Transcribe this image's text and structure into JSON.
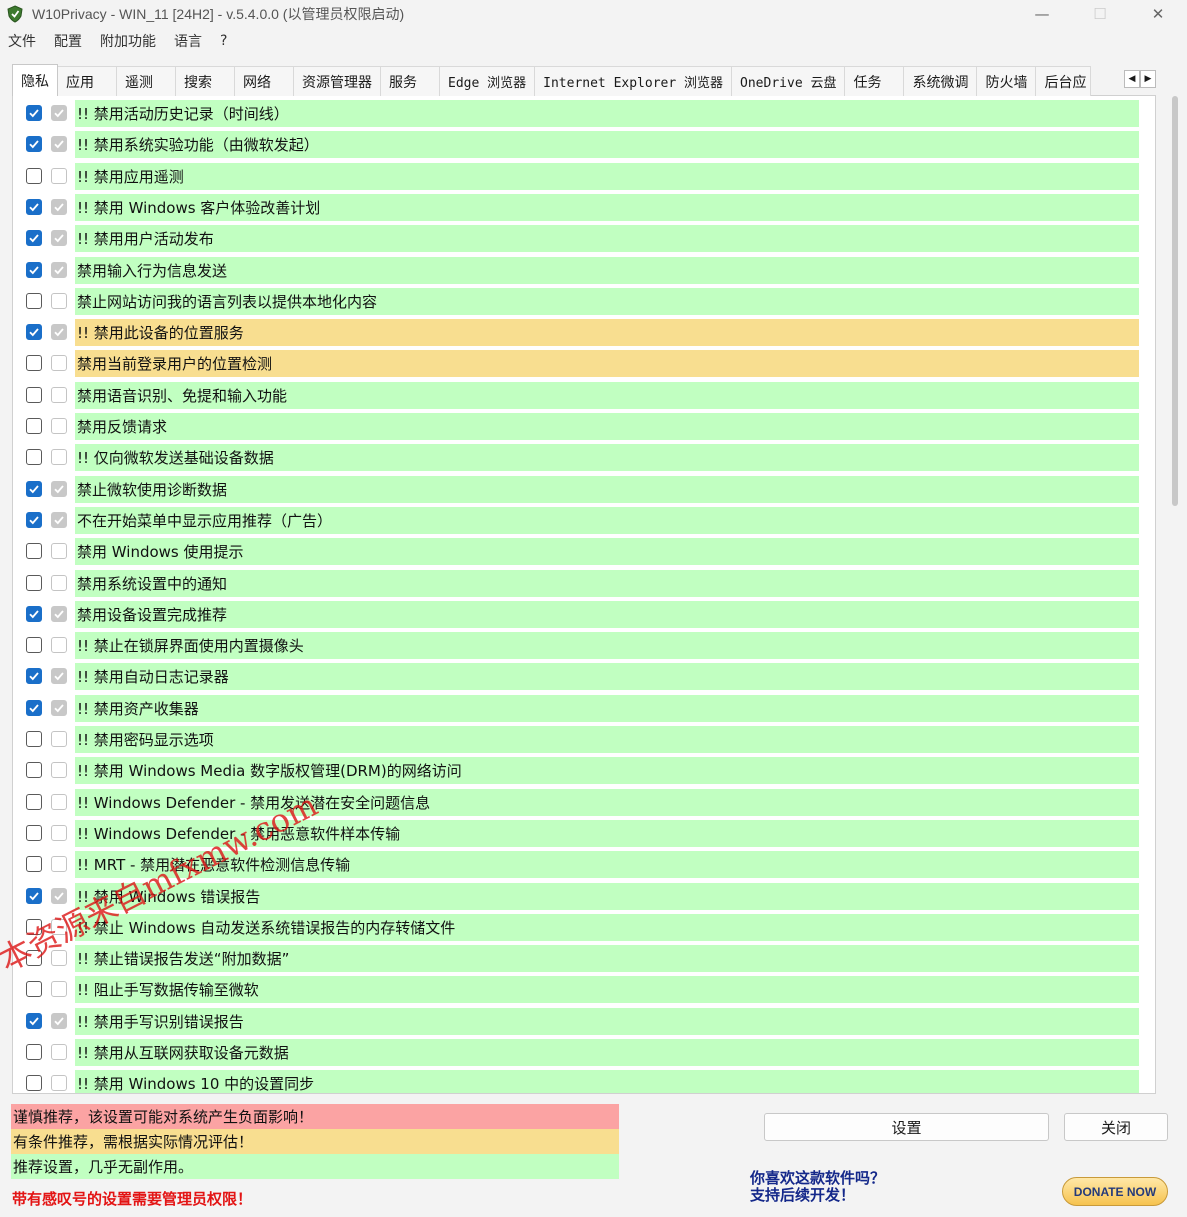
{
  "window": {
    "title": "W10Privacy - WIN_11 [24H2]  - v.5.4.0.0 (以管理员权限启动)",
    "minimize_glyph": "—",
    "maximize_glyph": "☐",
    "close_glyph": "✕"
  },
  "menu": [
    "文件",
    "配置",
    "附加功能",
    "语言",
    "?"
  ],
  "tabs": [
    "隐私",
    "应用",
    "遥测",
    "搜索",
    "网络",
    "资源管理器",
    "服务",
    "Edge 浏览器",
    "Internet Explorer 浏览器",
    "OneDrive 云盘",
    "任务",
    "系统微调",
    "防火墙",
    "后台应"
  ],
  "tab_scroll": [
    "◀",
    "▶"
  ],
  "settings": [
    {
      "label": "!! 禁用活动历史记录（时间线）",
      "checked": true,
      "rec_checked": true,
      "level": "green"
    },
    {
      "label": "!! 禁用系统实验功能（由微软发起）",
      "checked": true,
      "rec_checked": true,
      "level": "green"
    },
    {
      "label": "!! 禁用应用遥测",
      "checked": false,
      "rec_checked": false,
      "level": "green"
    },
    {
      "label": "!! 禁用 Windows 客户体验改善计划",
      "checked": true,
      "rec_checked": true,
      "level": "green"
    },
    {
      "label": "!! 禁用用户活动发布",
      "checked": true,
      "rec_checked": true,
      "level": "green"
    },
    {
      "label": "禁用输入行为信息发送",
      "checked": true,
      "rec_checked": true,
      "level": "green"
    },
    {
      "label": "禁止网站访问我的语言列表以提供本地化内容",
      "checked": false,
      "rec_checked": false,
      "level": "green"
    },
    {
      "label": "!! 禁用此设备的位置服务",
      "checked": true,
      "rec_checked": true,
      "level": "yellow"
    },
    {
      "label": "禁用当前登录用户的位置检测",
      "checked": false,
      "rec_checked": false,
      "level": "yellow"
    },
    {
      "label": "禁用语音识别、免提和输入功能",
      "checked": false,
      "rec_checked": false,
      "level": "green"
    },
    {
      "label": "禁用反馈请求",
      "checked": false,
      "rec_checked": false,
      "level": "green"
    },
    {
      "label": "!! 仅向微软发送基础设备数据",
      "checked": false,
      "rec_checked": false,
      "level": "green"
    },
    {
      "label": "禁止微软使用诊断数据",
      "checked": true,
      "rec_checked": true,
      "level": "green"
    },
    {
      "label": "不在开始菜单中显示应用推荐（广告）",
      "checked": true,
      "rec_checked": true,
      "level": "green"
    },
    {
      "label": "禁用 Windows 使用提示",
      "checked": false,
      "rec_checked": false,
      "level": "green"
    },
    {
      "label": "禁用系统设置中的通知",
      "checked": false,
      "rec_checked": false,
      "level": "green"
    },
    {
      "label": "禁用设备设置完成推荐",
      "checked": true,
      "rec_checked": true,
      "level": "green"
    },
    {
      "label": "!! 禁止在锁屏界面使用内置摄像头",
      "checked": false,
      "rec_checked": false,
      "level": "green"
    },
    {
      "label": "!! 禁用自动日志记录器",
      "checked": true,
      "rec_checked": true,
      "level": "green"
    },
    {
      "label": "!! 禁用资产收集器",
      "checked": true,
      "rec_checked": true,
      "level": "green"
    },
    {
      "label": "!! 禁用密码显示选项",
      "checked": false,
      "rec_checked": false,
      "level": "green"
    },
    {
      "label": "!! 禁用 Windows Media 数字版权管理(DRM)的网络访问",
      "checked": false,
      "rec_checked": false,
      "level": "green"
    },
    {
      "label": "!! Windows Defender - 禁用发送潜在安全问题信息",
      "checked": false,
      "rec_checked": false,
      "level": "green"
    },
    {
      "label": "!! Windows Defender - 禁用恶意软件样本传输",
      "checked": false,
      "rec_checked": false,
      "level": "green"
    },
    {
      "label": "!! MRT - 禁用潜在恶意软件检测信息传输",
      "checked": false,
      "rec_checked": false,
      "level": "green"
    },
    {
      "label": "!! 禁用 Windows 错误报告",
      "checked": true,
      "rec_checked": true,
      "level": "green"
    },
    {
      "label": "!! 禁止 Windows 自动发送系统错误报告的内存转储文件",
      "checked": false,
      "rec_checked": false,
      "level": "green"
    },
    {
      "label": "!! 禁止错误报告发送“附加数据”",
      "checked": false,
      "rec_checked": false,
      "level": "green"
    },
    {
      "label": "!! 阻止手写数据传输至微软",
      "checked": false,
      "rec_checked": false,
      "level": "green"
    },
    {
      "label": "!! 禁用手写识别错误报告",
      "checked": true,
      "rec_checked": true,
      "level": "green"
    },
    {
      "label": "!! 禁用从互联网获取设备元数据",
      "checked": false,
      "rec_checked": false,
      "level": "green"
    },
    {
      "label": "!! 禁用 Windows 10 中的设置同步",
      "checked": false,
      "rec_checked": false,
      "level": "green"
    }
  ],
  "legend": {
    "red": "谨慎推荐，该设置可能对系统产生负面影响！",
    "yellow": "有条件推荐，需根据实际情况评估！",
    "green": "推荐设置，几乎无副作用。"
  },
  "admin_note": "带有感叹号的设置需要管理员权限！",
  "buttons": {
    "apply": "设置",
    "close": "关闭"
  },
  "donate": {
    "line1": "你喜欢这款软件吗？",
    "line2": "支持后续开发！",
    "button": "DONATE NOW"
  },
  "watermark": "本资源来自mfxmw.com",
  "colors": {
    "green": "#c1ffc1",
    "yellow": "#f8de90",
    "red": "#fba3a3",
    "accent": "#1a6fc9"
  }
}
